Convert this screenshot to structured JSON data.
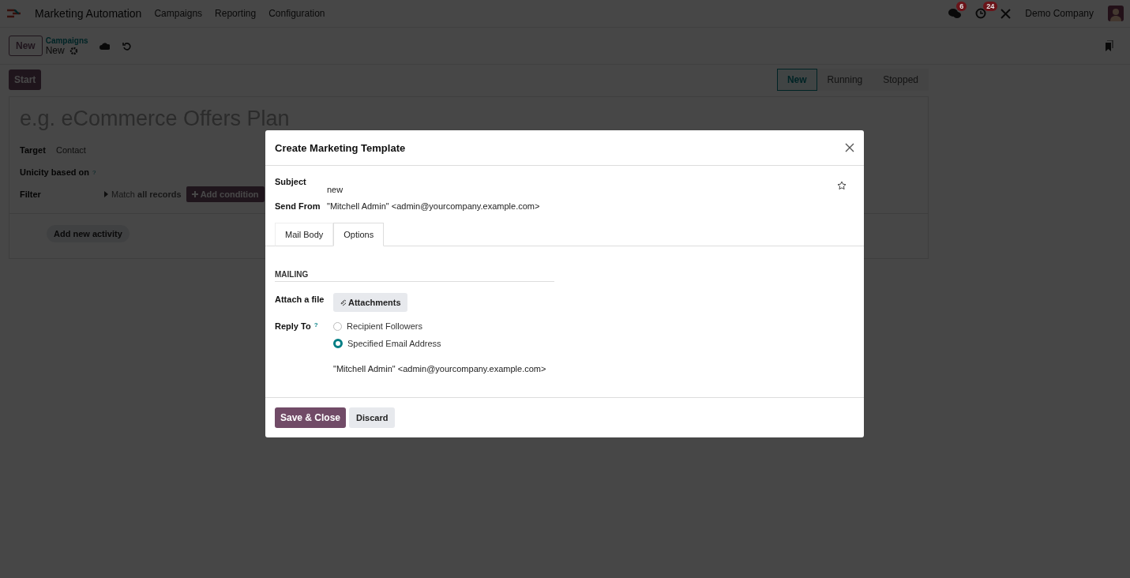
{
  "navbar": {
    "app_name": "Marketing Automation",
    "menu": [
      "Campaigns",
      "Reporting",
      "Configuration"
    ],
    "messages_badge": "6",
    "activities_badge": "24",
    "company": "Demo Company"
  },
  "control_panel": {
    "new_button": "New",
    "breadcrumb": "Campaigns",
    "record": "New"
  },
  "status_bar": {
    "start_button": "Start",
    "stages": [
      {
        "label": "New",
        "selected": true
      },
      {
        "label": "Running",
        "selected": false
      },
      {
        "label": "Stopped",
        "selected": false
      }
    ]
  },
  "form": {
    "name_placeholder": "e.g. eCommerce Offers Plan",
    "target_label": "Target",
    "target_value": "Contact",
    "unicity_label": "Unicity based on",
    "help_mark": "?",
    "filter_label": "Filter",
    "match_text": "Match **all records**",
    "add_condition": "Add condition",
    "add_activity": "Add new activity"
  },
  "dialog": {
    "title": "Create Marketing Template",
    "subject_label": "Subject",
    "subject_value": "new",
    "send_from_label": "Send From",
    "send_from_value": "\"Mitchell Admin\" <admin@yourcompany.example.com>",
    "tabs": [
      {
        "label": "Mail Body",
        "selected": false
      },
      {
        "label": "Options",
        "selected": true
      }
    ],
    "section": "MAILING",
    "attach_label": "Attach a file",
    "attachments_button": "Attachments",
    "reply_to_label": "Reply To",
    "help_mark": "?",
    "reply_options": [
      {
        "label": "Recipient Followers",
        "selected": false
      },
      {
        "label": "Specified Email Address",
        "selected": true
      }
    ],
    "reply_address": "\"Mitchell Admin\" <admin@yourcompany.example.com>",
    "buttons": {
      "save": "Save & Close",
      "discard": "Discard"
    }
  }
}
